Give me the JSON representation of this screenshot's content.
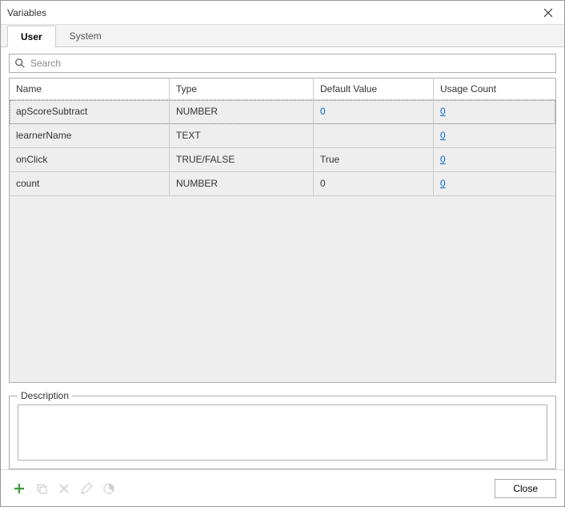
{
  "window": {
    "title": "Variables"
  },
  "tabs": {
    "user": "User",
    "system": "System",
    "active": "user"
  },
  "search": {
    "placeholder": "Search"
  },
  "columns": {
    "name": "Name",
    "type": "Type",
    "default": "Default Value",
    "usage": "Usage Count"
  },
  "rows": [
    {
      "name": "apScoreSubtract",
      "type": "NUMBER",
      "default": "0",
      "usage": "0",
      "selected": true,
      "numdefault": true
    },
    {
      "name": "learnerName",
      "type": "TEXT",
      "default": "",
      "usage": "0",
      "selected": false,
      "numdefault": false
    },
    {
      "name": "onClick",
      "type": "TRUE/FALSE",
      "default": "True",
      "usage": "0",
      "selected": false,
      "numdefault": false
    },
    {
      "name": "count",
      "type": "NUMBER",
      "default": "0",
      "usage": "0",
      "selected": false,
      "numdefault": false
    }
  ],
  "description": {
    "label": "Description",
    "value": ""
  },
  "footer": {
    "close": "Close"
  }
}
